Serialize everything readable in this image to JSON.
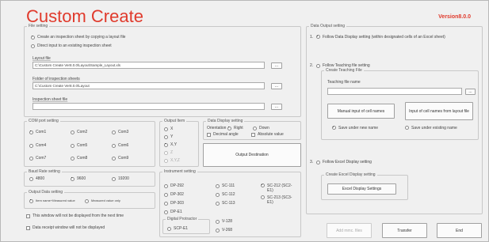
{
  "app": {
    "title": "Custom Create",
    "version": "Version8.0.0"
  },
  "file_setting": {
    "legend": "File setting",
    "opt_copy": "Create an inspection sheet by copying a layout file",
    "opt_direct": "Direct input to an existing inspection sheet",
    "layout_label": "Layout file",
    "layout_value": "C:\\Custom Create Ver8.0.0\\Layout\\Sample_Layout.xls",
    "folder_label": "Folder of inspection sheets",
    "folder_value": "C:\\Custom Create Ver8.0.0\\Layout",
    "sheet_label": "Inspection sheet file",
    "sheet_value": "",
    "browse": "..."
  },
  "com_port": {
    "legend": "COM port setting",
    "ports": [
      "Com1",
      "Com2",
      "Com3",
      "Com4",
      "Com5",
      "Com6",
      "Com7",
      "Com8",
      "Com9"
    ],
    "selected": "Com1"
  },
  "output_item": {
    "legend": "Output Item",
    "items": [
      "X",
      "Y",
      "X,Y",
      "Z",
      "X,Y,Z"
    ],
    "selected": "X,Y"
  },
  "data_display": {
    "legend": "Data Display setting",
    "orientation_label": "Orientation",
    "right": "Right",
    "down": "Down",
    "decimal": "Decimal angle",
    "absolute": "Absolute value"
  },
  "output_destination": "Output Destination",
  "baud_rate": {
    "legend": "Baud Rate setting",
    "rates": [
      "4800",
      "9600",
      "19200"
    ],
    "selected": "9600"
  },
  "output_data": {
    "legend": "Output Data setting",
    "opt1": "Item name+Measured value",
    "opt2": "Measured value only"
  },
  "footer_checks": {
    "not_displayed": "This window will not be displayed from the next time",
    "receipt": "Data receipt window will not be displayed"
  },
  "instrument": {
    "legend": "Instrument setting",
    "col1": [
      "DP-292",
      "DP-302",
      "DP-303",
      "DP-E1"
    ],
    "col2": [
      "SC-111",
      "SC-112",
      "SC-113"
    ],
    "col3": [
      "SC-212 (SC2-E1)",
      "SC-213 (SC3-E1)"
    ],
    "selected": "SC-212 (SC2-E1)",
    "protractor_legend": "Digital Protractor",
    "protractor": "SCP-E1",
    "v_items": [
      "V-128",
      "V-268"
    ]
  },
  "data_output": {
    "legend": "Data Output setting",
    "n1": "1.",
    "n2": "2.",
    "n3": "3.",
    "opt1": "Follow Data Display setting (within designated cells of an Excel sheet)",
    "opt2": "Follow Teaching file setting",
    "teach_legend": "Create Teaching File",
    "teach_name_label": "Teaching file name",
    "teach_name_value": "",
    "manual_btn": "Manual input of cell names",
    "layout_btn": "Input of cell names from layout file",
    "save_new": "Save under new name",
    "save_existing": "Save under existing name",
    "opt3": "Follow Excel Display setting",
    "excel_legend": "Create Excel Display setting",
    "excel_btn": "Excel Display Settings"
  },
  "buttons": {
    "add": "Add mmc. files",
    "transfer": "Transfer",
    "end": "End"
  }
}
